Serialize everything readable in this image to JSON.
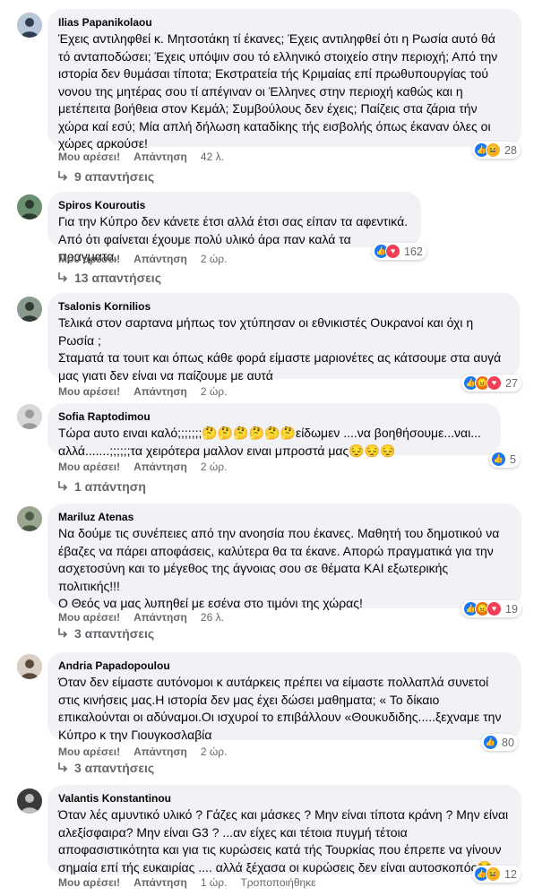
{
  "actions": {
    "like": "Μου αρέσει!",
    "reply": "Απάντηση"
  },
  "comments": [
    {
      "author": "Ilias Papanikolaou",
      "text": "Έχεις αντιληφθεί κ. Μητσοτάκη τί έκανες; Έχεις αντιληφθεί ότι η Ρωσία αυτό θά τό ανταποδώσει; Έχεις υπόψιν σου τό ελληνικό στοιχείο στην περιοχή; Από την ιστορία δεν θυμάσαι τίποτα; Εκστρατεία τής Κριμαίας επί πρωθυπουργίας τού νονου της μητέρας σου τί απέγιναν οι Έλληνες στην περιοχή καθώς και η μετέπειτα βοήθεια στον Κεμάλ; Συμβούλους δεν έχεις; Παίζεις στα ζάρια τήν χώρα καί εσύ; Μία απλή δήλωση καταδίκης τής εισβολής όπως έκαναν όλες οι χώρες αρκούσε!",
      "time": "42 λ.",
      "reactions": {
        "types": [
          "like",
          "haha"
        ],
        "count": "28"
      },
      "replies": "9 απαντήσεις",
      "avatar": {
        "bg": "#b8c6d9",
        "fg": "#2f3d52"
      }
    },
    {
      "author": "Spiros Kouroutis",
      "text": "Για την Κύπρο δεν κάνετε έτσι αλλά έτσι σας είπαν τα αφεντικά.\nΑπό ότι φαίνεται έχουμε πολύ υλικό άρα παν καλά τα πραγματα.",
      "time": "2 ώρ.",
      "reactions": {
        "types": [
          "like",
          "love"
        ],
        "count": "162"
      },
      "replies": "13 απαντήσεις",
      "avatar": {
        "bg": "#6b8f71",
        "fg": "#2b3b2d"
      }
    },
    {
      "author": "Tsalonis Kornilios",
      "text": "Τελικά στον σαρτανα μήπως τον χτύπησαν οι εθνικιστές Ουκρανοί και όχι η Ρωσία ;\nΣταματά τα τουιτ και όπως κάθε φορά είμαστε μαριονέτες ας κάτσουμε στα αυγά μας γιατι δεν είναι να παίζουμε με αυτά",
      "time": "2 ώρ.",
      "reactions": {
        "types": [
          "like",
          "angry",
          "love"
        ],
        "count": "27"
      },
      "replies": "",
      "avatar": {
        "bg": "#8a9a8c",
        "fg": "#2e3a33"
      }
    },
    {
      "author": "Sofia Raptodimou",
      "text": "Τώρα αυτο ειναι καλό;;;;;;;🤔🤔🤔🤔🤔🤔είδωμεν ....να βοηθήσουμε...ναι... αλλά.......;;;;;;τα χειρότερα μαλλον ειναι μπροστά μας😔😔😔",
      "time": "2 ώρ.",
      "reactions": {
        "types": [
          "like"
        ],
        "count": "5"
      },
      "replies": "1 απάντηση",
      "avatar": {
        "bg": "#d8d8d8",
        "fg": "#9a9a9a"
      }
    },
    {
      "author": "Mariluz Atenas",
      "text": "Να δούμε τις συνέπειες από την ανοησία που έκανες. Μαθητή του δημοτικού να έβαζες να πάρει αποφάσεις, καλύτερα θα τα έκανε. Απορώ πραγματικά για την ασχετοσύνη και το μέγεθος της άγνοιας σου σε θέματα ΚΑΙ εξωτερικής πολιτικής!!!\nΟ Θεός να μας λυπηθεί με εσένα στο τιμόνι της χώρας!",
      "time": "26 λ.",
      "reactions": {
        "types": [
          "like",
          "angry",
          "love"
        ],
        "count": "19"
      },
      "replies": "3 απαντήσεις",
      "avatar": {
        "bg": "#9aa68f",
        "fg": "#4d5a44"
      }
    },
    {
      "author": "Andria Papadopoulou",
      "text": "Όταν δεν είμαστε αυτόνομοι κ αυτάρκεις πρέπει να είμαστε πολλαπλά συνετοί στις κινήσεις μας.Η ιστορία δεν μας έχει δώσει μαθηματα; « Το δίκαιο επικαλούνται οι αδύναμοι.Οι ισχυροί το επιβάλλουν «Θουκυδιδης.....ξεχναμε την Κύπρο κ την Γιουγκοσλαβία",
      "time": "2 ώρ.",
      "reactions": {
        "types": [
          "like"
        ],
        "count": "80"
      },
      "replies": "3 απαντήσεις",
      "avatar": {
        "bg": "#d9cfc4",
        "fg": "#5a4a3c"
      }
    },
    {
      "author": "Valantis Konstantinou",
      "text": "Όταν λές αμυντικό υλικό ? Γάζες και μάσκες ? Μην είναι τίποτα κράνη ? Μην είναι αλεξίσφαιρα? Μην είναι G3 ? ...αν είχες και τέτοια πυγμή τέτοια αποφασιστικότητα και για τις κυρώσεις κατά τής Τουρκίας που έπρεπε να γίνουν σημαία επί τής ευκαιρίας .... αλλά ξέχασα οι κυρώσεις δεν είναι αυτοσκοπός😭",
      "time": "1 ώρ.",
      "edited": "Τροποποιήθηκε",
      "reactions": {
        "types": [
          "like",
          "haha"
        ],
        "count": "12"
      },
      "replies": "",
      "avatar": {
        "bg": "#3a3a3a",
        "fg": "#bfbfbf"
      }
    }
  ]
}
